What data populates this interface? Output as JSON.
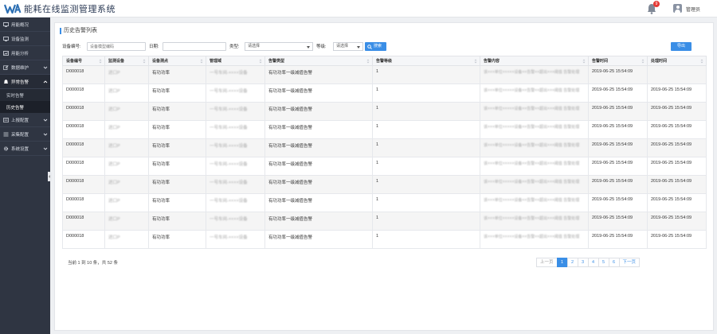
{
  "header": {
    "logo_text": "WA",
    "app_title": "能耗在线监测管理系统",
    "notification_count": "9",
    "username": "管理员"
  },
  "sidebar": {
    "items": [
      {
        "label": "用能概况",
        "icon": "monitor-icon"
      },
      {
        "label": "设备监测",
        "icon": "monitor-icon"
      },
      {
        "label": "用能分析",
        "icon": "chart-icon"
      },
      {
        "label": "数据维护",
        "icon": "edit-icon",
        "expandable": true
      },
      {
        "label": "异常告警",
        "icon": "alert-icon",
        "expandable": true,
        "expanded": true,
        "children": [
          {
            "label": "实时告警"
          },
          {
            "label": "历史告警",
            "current": true
          }
        ]
      },
      {
        "label": "上报配置",
        "icon": "upload-icon",
        "expandable": true
      },
      {
        "label": "采集配置",
        "icon": "list-icon",
        "expandable": true
      },
      {
        "label": "系统设置",
        "icon": "gear-icon",
        "expandable": true
      }
    ]
  },
  "main": {
    "title": "历史告警列表",
    "filters": {
      "device_no_label": "设备编号:",
      "device_no_placeholder": "设备模型编码",
      "date_label": "日期:",
      "date_value": "",
      "type_label": "类型:",
      "type_selected": "请选择",
      "level_label": "等级:",
      "level_selected": "请选择",
      "search_label": "搜索",
      "export_label": "导出"
    },
    "table": {
      "columns": [
        "设备编号",
        "监测设备",
        "设备测点",
        "管理域",
        "告警类型",
        "告警等级",
        "告警内容",
        "告警时间",
        "处理时间"
      ],
      "rows": [
        [
          "D000018",
          "进口P",
          "有功功率",
          "一号车间-××××设备",
          "有功功率一级减值告警",
          "1",
          "该×××单位×××××设备××告警××超出×××阈值 告警处理",
          "2019-06-25 15:54:09",
          ""
        ],
        [
          "D000018",
          "进口P",
          "有功功率",
          "一号车间-××××设备",
          "有功功率一级减值告警",
          "1",
          "该×××单位×××××设备××告警××超出×××阈值 告警处理",
          "2019-06-25 15:54:09",
          "2019-06-25 15:54:09"
        ],
        [
          "D000018",
          "进口P",
          "有功功率",
          "一号车间-××××设备",
          "有功功率一级减值告警",
          "1",
          "该×××单位×××××设备××告警××超出×××阈值 告警处理",
          "2019-06-25 15:54:09",
          "2019-06-25 15:54:09"
        ],
        [
          "D000018",
          "进口P",
          "有功功率",
          "一号车间-××××设备",
          "有功功率一级减值告警",
          "1",
          "该×××单位×××××设备××告警××超出×××阈值 告警处理",
          "2019-06-25 15:54:09",
          "2019-06-25 15:54:09"
        ],
        [
          "D000018",
          "进口P",
          "有功功率",
          "一号车间-××××设备",
          "有功功率一级减值告警",
          "1",
          "该×××单位×××××设备××告警××超出×××阈值 告警处理",
          "2019-06-25 15:54:09",
          "2019-06-25 15:54:09"
        ],
        [
          "D000018",
          "进口P",
          "有功功率",
          "一号车间-××××设备",
          "有功功率一级减值告警",
          "1",
          "该×××单位×××××设备××告警××超出×××阈值 告警处理",
          "2019-06-25 15:54:09",
          "2019-06-25 15:54:09"
        ],
        [
          "D000018",
          "进口P",
          "有功功率",
          "一号车间-××××设备",
          "有功功率一级减值告警",
          "1",
          "该×××单位×××××设备××告警××超出×××阈值 告警处理",
          "2019-06-25 15:54:09",
          "2019-06-25 15:54:09"
        ],
        [
          "D000018",
          "进口P",
          "有功功率",
          "一号车间-××××设备",
          "有功功率一级减值告警",
          "1",
          "该×××单位×××××设备××告警××超出×××阈值 告警处理",
          "2019-06-25 15:54:09",
          "2019-06-25 15:54:09"
        ],
        [
          "D000018",
          "进口P",
          "有功功率",
          "一号车间-××××设备",
          "有功功率一级减值告警",
          "1",
          "该×××单位×××××设备××告警××超出×××阈值 告警处理",
          "2019-06-25 15:54:09",
          "2019-06-25 15:54:09"
        ],
        [
          "D000018",
          "进口P",
          "有功功率",
          "一号车间-××××设备",
          "有功功率一级减值告警",
          "1",
          "该×××单位×××××设备××告警××超出×××阈值 告警处理",
          "2019-06-25 15:54:09",
          "2019-06-25 15:54:09"
        ]
      ]
    },
    "pagination": {
      "info": "当前 1 到 10 条，共 52 条",
      "prev_label": "上一页",
      "next_label": "下一页",
      "pages": [
        "1",
        "2",
        "3",
        "4",
        "5",
        "6"
      ],
      "current_page": "1"
    }
  },
  "colors": {
    "accent": "#3a8ee6",
    "sidebar_bg": "#2f3542",
    "badge": "#e53935"
  }
}
